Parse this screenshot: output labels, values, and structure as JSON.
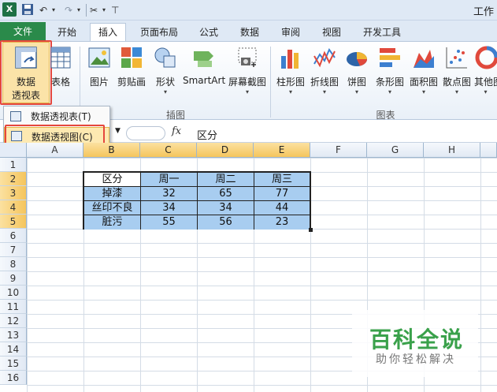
{
  "window": {
    "title": "工作"
  },
  "ribbon_tabs": [
    {
      "label": "文件"
    },
    {
      "label": "开始"
    },
    {
      "label": "插入"
    },
    {
      "label": "页面布局"
    },
    {
      "label": "公式"
    },
    {
      "label": "数据"
    },
    {
      "label": "审阅"
    },
    {
      "label": "视图"
    },
    {
      "label": "开发工具"
    }
  ],
  "ribbon": {
    "pivot": {
      "label1": "数据",
      "label2": "透视表"
    },
    "table_label": "表格",
    "picture_label": "图片",
    "clipart_label": "剪贴画",
    "shapes_label": "形状",
    "smartart_label": "SmartArt",
    "screenshot_label": "屏幕截图",
    "illustrations_group": "插图",
    "column_chart_label": "柱形图",
    "line_chart_label": "折线图",
    "pie_chart_label": "饼图",
    "bar_chart_label": "条形图",
    "area_chart_label": "面积图",
    "scatter_chart_label": "散点图",
    "other_chart_label": "其他图",
    "charts_group": "图表"
  },
  "menu": {
    "pivot_table": "数据透视表(T)",
    "pivot_chart": "数据透视图(C)"
  },
  "formula_bar": {
    "fx": "fx",
    "value": "区分"
  },
  "columns": [
    "A",
    "B",
    "C",
    "D",
    "E",
    "F",
    "G",
    "H"
  ],
  "rows": [
    "1",
    "2",
    "3",
    "4",
    "5",
    "6",
    "7",
    "8",
    "9",
    "10",
    "11",
    "12",
    "13",
    "14",
    "15",
    "16"
  ],
  "table": {
    "headers": [
      "区分",
      "周一",
      "周二",
      "周三"
    ],
    "rows": [
      [
        "掉漆",
        "32",
        "65",
        "77"
      ],
      [
        "丝印不良",
        "34",
        "34",
        "44"
      ],
      [
        "脏污",
        "55",
        "56",
        "23"
      ]
    ]
  },
  "watermark": {
    "main": "百科全说",
    "sub": "助你轻松解决"
  },
  "colors": {
    "file_tab": "#2a8a4a",
    "highlight_red": "#e5473d",
    "selection": "#a8cdf0",
    "watermark_green": "#3aa14b"
  }
}
